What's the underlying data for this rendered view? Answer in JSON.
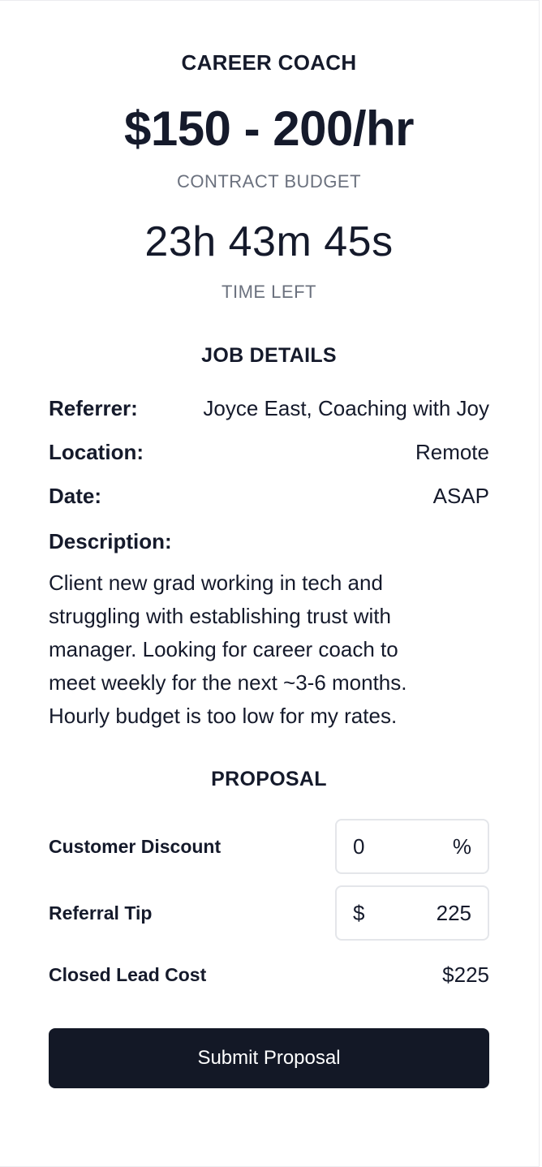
{
  "header": {
    "job_title": "CAREER COACH",
    "budget_value": "$150 - 200/hr",
    "budget_label": "CONTRACT BUDGET",
    "time_value": "23h 43m 45s",
    "time_label": "TIME LEFT"
  },
  "job_details": {
    "heading": "JOB DETAILS",
    "referrer_label": "Referrer:",
    "referrer_value": "Joyce East, Coaching with Joy",
    "location_label": "Location:",
    "location_value": "Remote",
    "date_label": "Date:",
    "date_value": "ASAP",
    "description_label": "Description:",
    "description_lines": [
      "Client new grad working in tech and",
      "struggling with establishing trust with",
      "manager. Looking for career coach to",
      "meet weekly for the next ~3-6 months.",
      "Hourly budget is too low for my rates."
    ]
  },
  "proposal": {
    "heading": "PROPOSAL",
    "discount_label": "Customer Discount",
    "discount_value": "0",
    "discount_unit": "%",
    "tip_label": "Referral Tip",
    "tip_currency": "$",
    "tip_value": "225",
    "cost_label": "Closed Lead Cost",
    "cost_value": "$225",
    "submit_label": "Submit Proposal"
  },
  "colors": {
    "text_primary": "#151a2b",
    "text_muted": "#6b717e",
    "button_bg": "#131826",
    "field_border": "#e4e6ea"
  }
}
